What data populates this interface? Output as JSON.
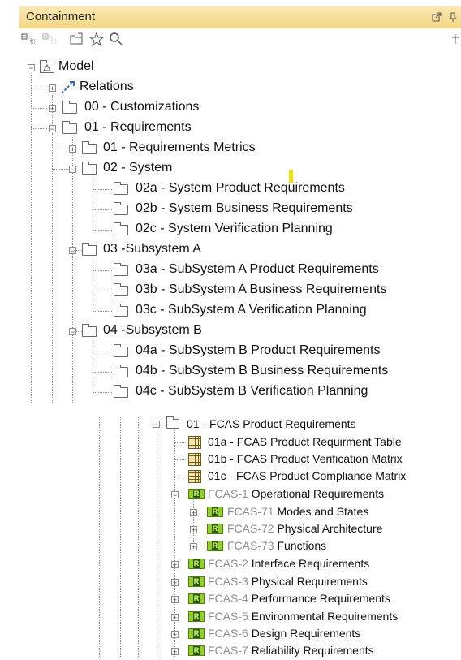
{
  "panel": {
    "title": "Containment"
  },
  "toolbar": {
    "icons": [
      "collapse-all-icon",
      "expand-all-icon",
      "open-folder-icon",
      "star-icon",
      "search-icon"
    ]
  },
  "tree": {
    "model": "Model",
    "relations": "Relations",
    "customizations": "00 - Customizations",
    "requirements": "01 - Requirements",
    "req_metrics": "01 - Requirements Metrics",
    "system": "02 - System",
    "sys_a": "02a - System Product Requirements",
    "sys_b": "02b - System Business Requirements",
    "sys_c": "02c - System Verification Planning",
    "subA": "03 -Subsystem A",
    "subA_a": "03a - SubSystem A Product Requirements",
    "subA_b": "03b - SubSystem A Business Requirements",
    "subA_c": "03c - SubSystem A Verification Planning",
    "subB": "04 -Subsystem B",
    "subB_a": "04a - SubSystem B Product Requirements",
    "subB_b": "04b - SubSystem B Business Requirements",
    "subB_c": "04c - SubSystem B Verification Planning"
  },
  "lower_tree": {
    "fcas_product": "01 - FCAS Product Requirements",
    "table_a": "01a - FCAS Product Requirment Table",
    "table_b": "01b - FCAS Product Verification Matrix",
    "table_c": "01c - FCAS Product Compliance Matrix",
    "items": [
      {
        "id": "FCAS-1",
        "name": "Operational Requirements"
      },
      {
        "id": "FCAS-71",
        "name": "Modes and States"
      },
      {
        "id": "FCAS-72",
        "name": "Physical Architecture"
      },
      {
        "id": "FCAS-73",
        "name": "Functions"
      },
      {
        "id": "FCAS-2",
        "name": "Interface Requirements"
      },
      {
        "id": "FCAS-3",
        "name": "Physical Requirements"
      },
      {
        "id": "FCAS-4",
        "name": "Performance Requirements"
      },
      {
        "id": "FCAS-5",
        "name": "Environmental Requirements"
      },
      {
        "id": "FCAS-6",
        "name": "Design Requirements"
      },
      {
        "id": "FCAS-7",
        "name": "Reliability Requirements"
      }
    ],
    "req_icon_letter": "R"
  }
}
